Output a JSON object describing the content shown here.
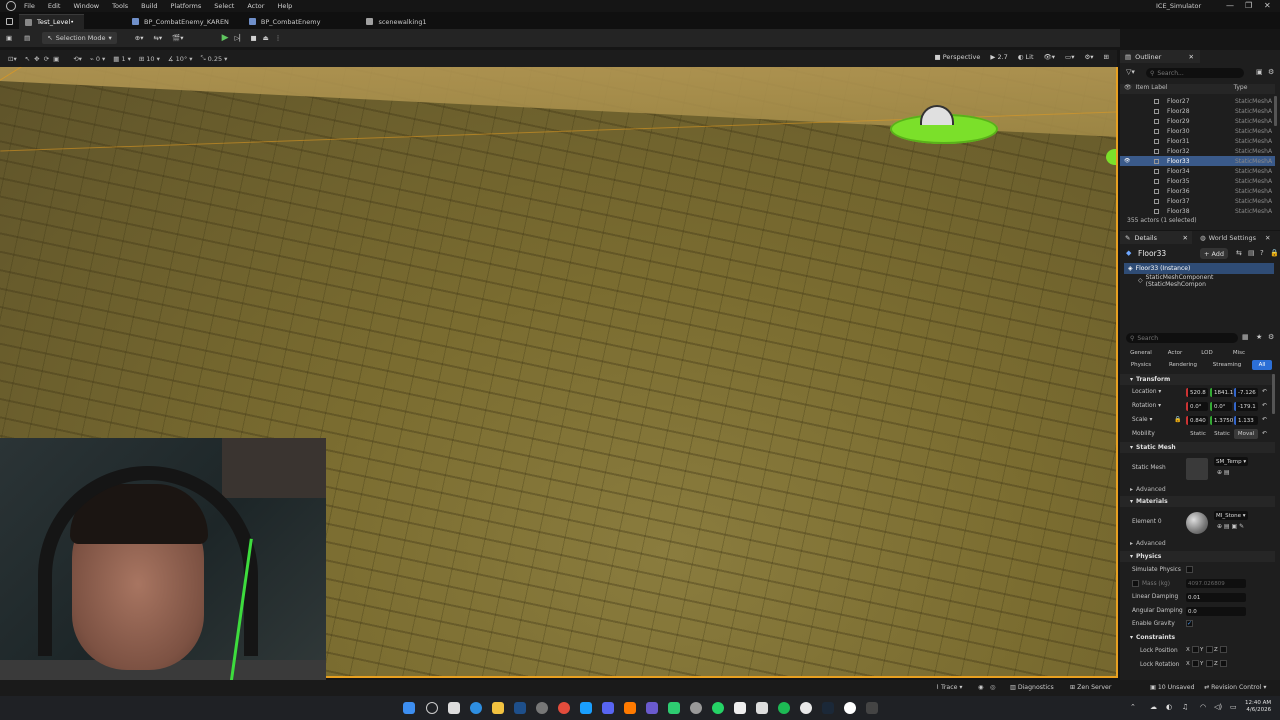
{
  "menu": {
    "items": [
      "File",
      "Edit",
      "Window",
      "Tools",
      "Build",
      "Platforms",
      "Select",
      "Actor",
      "Help"
    ]
  },
  "app_title": "ICE_Simulator",
  "tabs": [
    {
      "label": "Test_Level•"
    },
    {
      "label": "BP_CombatEnemy_KAREN"
    },
    {
      "label": "BP_CombatEnemy"
    },
    {
      "label": "scenewalking1"
    }
  ],
  "toolbar": {
    "selection_mode": "Selection Mode"
  },
  "viewport_toolbar": {
    "grid_snap": "10",
    "rot_snap": "10°",
    "scale_snap": "0.25",
    "view_mode": "Perspective",
    "fov": "2.7",
    "lit": "Lit",
    "count_a": "0",
    "count_b": "1"
  },
  "outliner": {
    "tab_label": "Outliner",
    "search_placeholder": "Search...",
    "col_label": "Item Label",
    "col_type": "Type",
    "rows": [
      {
        "label": "Floor27",
        "type": "StaticMeshA"
      },
      {
        "label": "Floor28",
        "type": "StaticMeshA"
      },
      {
        "label": "Floor29",
        "type": "StaticMeshA"
      },
      {
        "label": "Floor30",
        "type": "StaticMeshA"
      },
      {
        "label": "Floor31",
        "type": "StaticMeshA"
      },
      {
        "label": "Floor32",
        "type": "StaticMeshA"
      },
      {
        "label": "Floor33",
        "type": "StaticMeshA"
      },
      {
        "label": "Floor34",
        "type": "StaticMeshA"
      },
      {
        "label": "Floor35",
        "type": "StaticMeshA"
      },
      {
        "label": "Floor36",
        "type": "StaticMeshA"
      },
      {
        "label": "Floor37",
        "type": "StaticMeshA"
      },
      {
        "label": "Floor38",
        "type": "StaticMeshA"
      }
    ],
    "selected_index": 6,
    "actor_count": "355 actors (1 selected)"
  },
  "details": {
    "tab_label": "Details",
    "world_settings_label": "World Settings",
    "object_name": "Floor33",
    "add_label": "+ Add",
    "instance_label": "Floor33 (Instance)",
    "component_label": "StaticMeshComponent (StaticMeshCompon",
    "search_placeholder": "Search",
    "categories_row1": [
      "General",
      "Actor",
      "LOD",
      "Misc"
    ],
    "categories_row2": [
      "Physics",
      "Rendering",
      "Streaming",
      "All"
    ],
    "transform_header": "Transform",
    "location_label": "Location",
    "location": [
      "520.8",
      "1841.1",
      "-7.126"
    ],
    "rotation_label": "Rotation",
    "rotation": [
      "0.0°",
      "0.0°",
      "-179.1"
    ],
    "scale_label": "Scale",
    "scale": [
      "0.840",
      "1.3750",
      "1.133"
    ],
    "mobility_label": "Mobility",
    "mobility_options": [
      "Static",
      "Static",
      "Moval"
    ],
    "static_mesh_header": "Static Mesh",
    "static_mesh_label": "Static Mesh",
    "static_mesh_value": "SM_Temp",
    "advanced_label": "Advanced",
    "materials_header": "Materials",
    "element_label": "Element 0",
    "material_value": "MI_Stone",
    "advanced_label2": "Advanced",
    "physics_header": "Physics",
    "simulate_label": "Simulate Physics",
    "mass_label": "Mass (kg)",
    "mass_value": "4097.026809",
    "linear_label": "Linear Damping",
    "linear_value": "0.01",
    "angular_label": "Angular Damping",
    "angular_value": "0.0",
    "gravity_label": "Enable Gravity",
    "constraints_header": "Constraints",
    "lock_pos_label": "Lock Position",
    "lock_rot_label": "Lock Rotation",
    "axis_letters": [
      "X",
      "Y",
      "Z"
    ]
  },
  "statusbar": {
    "trace": "Trace",
    "diagnostics": "Diagnostics",
    "zen": "Zen Server",
    "unsaved": "10 Unsaved",
    "revision": "Revision Control"
  },
  "clock": {
    "time": "12:40 AM",
    "date": "4/6/2026"
  }
}
